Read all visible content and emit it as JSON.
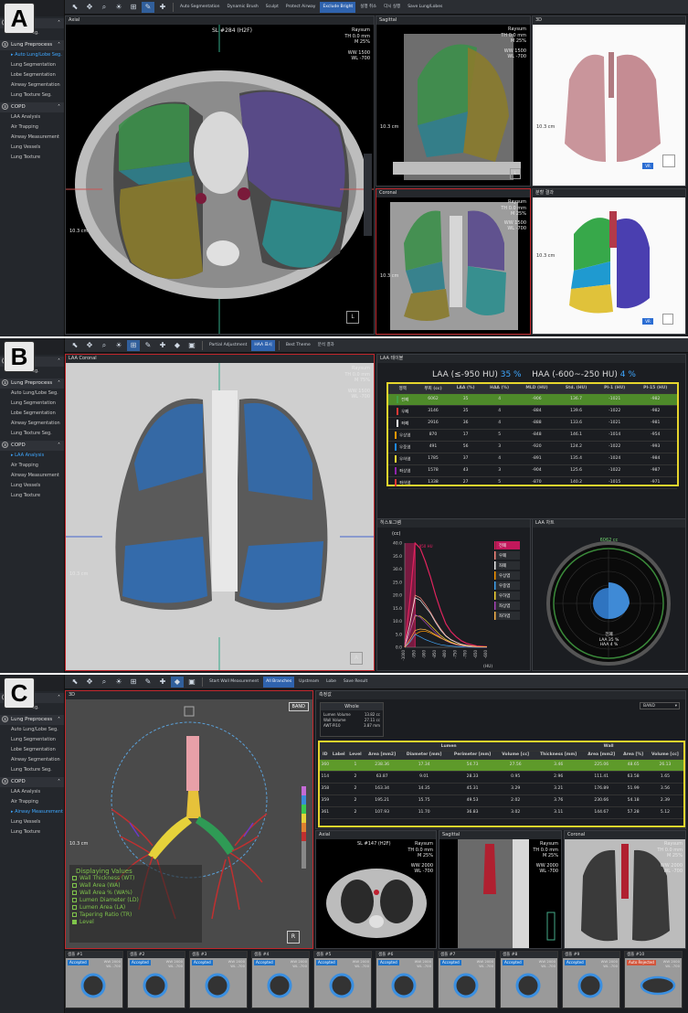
{
  "panel_a": {
    "label": "A",
    "sidebar": {
      "search": "st",
      "sections": [
        {
          "num": "①",
          "title": "Modeler",
          "items": [
            {
              "label": "Manual Seg.",
              "active": false
            }
          ]
        },
        {
          "num": "②",
          "title": "Lung Preprocess",
          "items": [
            {
              "label": "Auto Lung/Lobe Seg.",
              "active": true
            },
            {
              "label": "Lung Segmentation",
              "active": false
            },
            {
              "label": "Lobe Segmentation",
              "active": false
            },
            {
              "label": "Airway Segmentation",
              "active": false
            },
            {
              "label": "Lung Texture Seg.",
              "active": false
            }
          ]
        },
        {
          "num": "③",
          "title": "COPD",
          "items": [
            {
              "label": "LAA Analysis",
              "active": false
            },
            {
              "label": "Air Trapping",
              "active": false
            },
            {
              "label": "Airway Measurement",
              "active": false
            },
            {
              "label": "Lung Vessels",
              "active": false
            },
            {
              "label": "Lung Texture",
              "active": false
            }
          ]
        }
      ]
    },
    "toolbar": [
      "Auto Segmentation",
      "Dynamic Brush",
      "Sculpt",
      "Protect Airway",
      "Exclude Bright",
      "실행 취소",
      "다시 실행",
      "Save Lung/Lobes"
    ],
    "axial": {
      "title": "Axial",
      "slice": "SL #284 (H2F)",
      "brand": "Raysum",
      "th": "TH 0.0 mm",
      "zoom": "M 25%",
      "ww": "WW  1500",
      "wl": "WL  -700",
      "scale": "10.3 cm",
      "orient": "L"
    },
    "sagittal": {
      "title": "Sagittal",
      "brand": "Raysum",
      "th": "TH 0.0 mm",
      "zoom": "M 25%",
      "ww": "WW  1500",
      "wl": "WL  -700",
      "scale": "10.3 cm",
      "orient": "L"
    },
    "coronal": {
      "title": "Coronal",
      "brand": "Raysum",
      "th": "TH 0.0 mm",
      "zoom": "M 25%",
      "ww": "WW 1500",
      "wl": "WL -700",
      "scale": "10.3 cm"
    },
    "view3d": {
      "title": "3D",
      "scale": "10.3 cm",
      "tag": "VR"
    },
    "lobes": {
      "title": "분할 결과",
      "scale": "10.3 cm",
      "tag": "VR"
    }
  },
  "panel_b": {
    "label": "B",
    "sidebar": {
      "search": "st",
      "sections": [
        {
          "num": "①",
          "title": "Modeler",
          "items": [
            {
              "label": "Manual Seg.",
              "active": false
            }
          ]
        },
        {
          "num": "②",
          "title": "Lung Preprocess",
          "items": [
            {
              "label": "Auto Lung/Lobe Seg.",
              "active": false
            },
            {
              "label": "Lung Segmentation",
              "active": false
            },
            {
              "label": "Lobe Segmentation",
              "active": false
            },
            {
              "label": "Airway Segmentation",
              "active": false
            },
            {
              "label": "Lung Texture Seg.",
              "active": false
            }
          ]
        },
        {
          "num": "③",
          "title": "COPD",
          "items": [
            {
              "label": "LAA Analysis",
              "active": true
            },
            {
              "label": "Air Trapping",
              "active": false
            },
            {
              "label": "Airway Measurement",
              "active": false
            },
            {
              "label": "Lung Vessels",
              "active": false
            },
            {
              "label": "Lung Texture",
              "active": false
            }
          ]
        }
      ]
    },
    "toolbar": [
      "Partial Adjustment",
      "HAA 표시",
      "Best Theme",
      "분석 결과"
    ],
    "coronal": {
      "title": "LAA Coronal",
      "brand": "Raysum",
      "th": "TH 0.0 mm",
      "zoom": "M 75%",
      "ww": "WW  1500",
      "wl": "WL  -700",
      "scale": "10.3 cm",
      "orient": "A"
    },
    "table_title": "LAA 테이블",
    "summary": {
      "laa_label": "LAA (≤-950 HU)",
      "laa_value": "35 %",
      "haa_label": "HAA (-600~-250 HU)",
      "haa_value": "4 %"
    },
    "table": {
      "headers": [
        "영역",
        "부피 (cc)",
        "LAA (%)",
        "HAA (%)",
        "MLD (HU)",
        "Std. (HU)",
        "PI-1 (HU)",
        "PI-15 (HU)"
      ],
      "rows": [
        {
          "color": "#43a047",
          "cells": [
            "전폐",
            "6062",
            "35",
            "4",
            "-906",
            "136.7",
            "-1021",
            "-982"
          ],
          "selected": true
        },
        {
          "color": "#e53935",
          "cells": [
            "우폐",
            "3146",
            "35",
            "4",
            "-884",
            "139.6",
            "-1022",
            "-982"
          ]
        },
        {
          "color": "#ffffff",
          "cells": [
            "좌폐",
            "2916",
            "36",
            "4",
            "-888",
            "133.6",
            "-1021",
            "-981"
          ]
        },
        {
          "color": "#ff9800",
          "cells": [
            "우상엽",
            "870",
            "17",
            "5",
            "-848",
            "146.1",
            "-1014",
            "-954"
          ]
        },
        {
          "color": "#1e88e5",
          "cells": [
            "우중엽",
            "491",
            "56",
            "3",
            "-920",
            "124.2",
            "-1022",
            "-993"
          ]
        },
        {
          "color": "#fdd835",
          "cells": [
            "우하엽",
            "1785",
            "37",
            "4",
            "-891",
            "135.4",
            "-1024",
            "-984"
          ]
        },
        {
          "color": "#8e24aa",
          "cells": [
            "좌상엽",
            "1578",
            "43",
            "3",
            "-904",
            "125.6",
            "-1022",
            "-987"
          ]
        },
        {
          "color": "#e53935",
          "cells": [
            "좌하엽",
            "1338",
            "27",
            "5",
            "-870",
            "140.2",
            "-1015",
            "-971"
          ]
        }
      ]
    },
    "histogram": {
      "title": "히스토그램",
      "unit": "(cc)",
      "xunit": "(HU)",
      "marker": "-950 HU",
      "legend": [
        "전폐",
        "우폐",
        "좌폐",
        "우상엽",
        "우중엽",
        "우하엽",
        "좌상엽",
        "좌하엽"
      ]
    },
    "chart": {
      "title": "LAA 차트",
      "volume": "6062 cc",
      "label": "전폐",
      "laa": "LAA 35 %",
      "haa": "HAA 4 %"
    }
  },
  "chart_data": {
    "type": "line",
    "title": "히스토그램",
    "ylabel": "(cc)",
    "xlabel": "(HU)",
    "ylim": [
      0,
      40
    ],
    "yticks": [
      "40.0",
      "35.0",
      "30.0",
      "25.0",
      "20.0",
      "15.0",
      "10.0",
      "5.0",
      "0.0"
    ],
    "xticks": [
      "-1000",
      "-950",
      "-900",
      "-850",
      "-800",
      "-750",
      "-700",
      "-650",
      "-600"
    ],
    "x": [
      -1000,
      -975,
      -950,
      -925,
      -900,
      -875,
      -850,
      -825,
      -800,
      -775,
      -750,
      -725,
      -700,
      -650,
      -600
    ],
    "series": [
      {
        "name": "전폐",
        "color": "#e0245e",
        "values": [
          0,
          18,
          40,
          38,
          33,
          27,
          20,
          14,
          9,
          6,
          4,
          2.5,
          1.5,
          0.5,
          0.2
        ]
      },
      {
        "name": "우폐",
        "color": "#ff8a80",
        "values": [
          0,
          9,
          20,
          19,
          16.5,
          13.5,
          10,
          7,
          4.5,
          3,
          2,
          1.2,
          0.8,
          0.3,
          0.1
        ]
      },
      {
        "name": "좌폐",
        "color": "#eeeeee",
        "values": [
          0,
          9,
          19,
          18,
          15.5,
          13,
          9.5,
          6.5,
          4.3,
          2.8,
          1.9,
          1.1,
          0.7,
          0.2,
          0.1
        ]
      },
      {
        "name": "우상엽",
        "color": "#ff9800",
        "values": [
          0,
          2,
          5,
          6,
          6.2,
          5.5,
          4.5,
          3.5,
          2.6,
          1.8,
          1.2,
          0.8,
          0.5,
          0.2,
          0.1
        ]
      },
      {
        "name": "우중엽",
        "color": "#42a5f5",
        "values": [
          0,
          2,
          5,
          4,
          3,
          2.2,
          1.5,
          1,
          0.7,
          0.5,
          0.3,
          0.2,
          0.1,
          0,
          0
        ]
      },
      {
        "name": "우하엽",
        "color": "#fdd835",
        "values": [
          0,
          6,
          12,
          12,
          10.5,
          8.5,
          6.5,
          4.5,
          3,
          2,
          1.3,
          0.8,
          0.5,
          0.2,
          0.1
        ]
      },
      {
        "name": "좌상엽",
        "color": "#ab47bc",
        "values": [
          0,
          6,
          12.5,
          11.5,
          9.5,
          7.5,
          5.5,
          3.8,
          2.5,
          1.6,
          1,
          0.6,
          0.4,
          0.1,
          0
        ]
      },
      {
        "name": "좌하엽",
        "color": "#ffb74d",
        "values": [
          0,
          3,
          6.5,
          7,
          6.8,
          6,
          4.8,
          3.6,
          2.6,
          1.8,
          1.2,
          0.8,
          0.5,
          0.2,
          0.1
        ]
      }
    ]
  },
  "panel_c": {
    "label": "C",
    "sidebar": {
      "search": "st",
      "sections": [
        {
          "num": "①",
          "title": "Modeler",
          "items": [
            {
              "label": "Manual Seg.",
              "active": false
            }
          ]
        },
        {
          "num": "②",
          "title": "Lung Preprocess",
          "items": [
            {
              "label": "Auto Lung/Lobe Seg.",
              "active": false
            },
            {
              "label": "Lung Segmentation",
              "active": false
            },
            {
              "label": "Lobe Segmentation",
              "active": false
            },
            {
              "label": "Airway Segmentation",
              "active": false
            },
            {
              "label": "Lung Texture Seg.",
              "active": false
            }
          ]
        },
        {
          "num": "③",
          "title": "COPD",
          "items": [
            {
              "label": "LAA Analysis",
              "active": false
            },
            {
              "label": "Air Trapping",
              "active": false
            },
            {
              "label": "Airway Measurement",
              "active": true
            },
            {
              "label": "Lung Vessels",
              "active": false
            },
            {
              "label": "Lung Texture",
              "active": false
            }
          ]
        }
      ]
    },
    "toolbar": [
      "Start Wall Measurement",
      "All Branches",
      "Upstream",
      "Lobe",
      "Save Result"
    ],
    "view3d": {
      "title": "3D",
      "band": "BAND",
      "scale": "10.3 cm",
      "orient": "R"
    },
    "displaying": {
      "title": "Displaying Values",
      "items": [
        "Wall Thickness (WT)",
        "Wall Area (WA)",
        "Wall Area % (WA%)",
        "Lumen Diameter (LD)",
        "Lumen Area (LA)",
        "Tapering Ratio (TR)",
        "Level"
      ],
      "checked": [
        false,
        false,
        false,
        false,
        false,
        false,
        true
      ]
    },
    "result_title": "측정값",
    "band_select": "BAND",
    "whole": {
      "title": "Whole",
      "rows": [
        [
          "Lumen Volume",
          "13.82 cc"
        ],
        [
          "Wall Volume",
          "27.11 cc"
        ],
        [
          "AWT-Pi10",
          "3.87 mm"
        ]
      ]
    },
    "table": {
      "group_headers": [
        "Lumen",
        "Wall"
      ],
      "headers": [
        "ID",
        "Label",
        "Level",
        "Area [mm2]",
        "Diameter [mm]",
        "Perimeter [mm]",
        "Volume [cc]",
        "Thickness [mm]",
        "Area [mm2]",
        "Area [%]",
        "Volume [cc]"
      ],
      "rows": [
        {
          "cells": [
            "360",
            "",
            "1",
            "238.36",
            "17.34",
            "54.73",
            "27.56",
            "3.46",
            "225.06",
            "48.65",
            "26.13"
          ],
          "selected": true
        },
        {
          "cells": [
            "114",
            "",
            "2",
            "63.87",
            "9.01",
            "28.33",
            "0.95",
            "2.96",
            "111.41",
            "63.58",
            "1.65"
          ]
        },
        {
          "cells": [
            "358",
            "",
            "2",
            "163.34",
            "14.35",
            "45.31",
            "3.29",
            "3.21",
            "176.89",
            "51.99",
            "3.56"
          ]
        },
        {
          "cells": [
            "359",
            "",
            "2",
            "195.21",
            "15.75",
            "49.53",
            "2.02",
            "3.76",
            "230.66",
            "54.18",
            "2.39"
          ]
        },
        {
          "cells": [
            "361",
            "",
            "2",
            "107.93",
            "11.70",
            "36.83",
            "3.02",
            "3.11",
            "144.67",
            "57.28",
            "5.12"
          ]
        }
      ]
    },
    "axial": {
      "title": "Axial",
      "slice": "SL #147 (H2F)",
      "brand": "Raysum",
      "th": "TH 0.0 mm",
      "zoom": "M 25%",
      "ww": "WW 2000",
      "wl": "WL -700"
    },
    "sagittal": {
      "title": "Sagittal",
      "brand": "Raysum",
      "th": "TH 0.0 mm",
      "zoom": "M 25%",
      "ww": "WW 2000",
      "wl": "WL -700"
    },
    "coronal": {
      "title": "Coronal",
      "brand": "Raysum",
      "th": "TH 0.0 mm",
      "zoom": "M 25%",
      "ww": "WW 2000",
      "wl": "WL -700"
    },
    "thumbs": [
      {
        "title": "샘플 #1",
        "badge": "Accepted",
        "ww": "WW 2000",
        "wl": "WL -700",
        "rejected": false
      },
      {
        "title": "샘플 #2",
        "badge": "Accepted",
        "ww": "WW 2000",
        "wl": "WL -700",
        "rejected": false
      },
      {
        "title": "샘플 #3",
        "badge": "Accepted",
        "ww": "WW 2000",
        "wl": "WL -700",
        "rejected": false
      },
      {
        "title": "샘플 #4",
        "badge": "Accepted",
        "ww": "WW 2000",
        "wl": "WL -700",
        "rejected": false
      },
      {
        "title": "샘플 #5",
        "badge": "Accepted",
        "ww": "WW 2000",
        "wl": "WL -700",
        "rejected": false
      },
      {
        "title": "샘플 #6",
        "badge": "Accepted",
        "ww": "WW 2000",
        "wl": "WL -700",
        "rejected": false
      },
      {
        "title": "샘플 #7",
        "badge": "Accepted",
        "ww": "WW 2000",
        "wl": "WL -700",
        "rejected": false
      },
      {
        "title": "샘플 #8",
        "badge": "Accepted",
        "ww": "WW 2000",
        "wl": "WL -700",
        "rejected": false
      },
      {
        "title": "샘플 #9",
        "badge": "Accepted",
        "ww": "WW 2000",
        "wl": "WL -700",
        "rejected": false
      },
      {
        "title": "샘플 #10",
        "badge": "Auto Rejected",
        "ww": "WW 2000",
        "wl": "WL -700",
        "rejected": true
      }
    ]
  }
}
